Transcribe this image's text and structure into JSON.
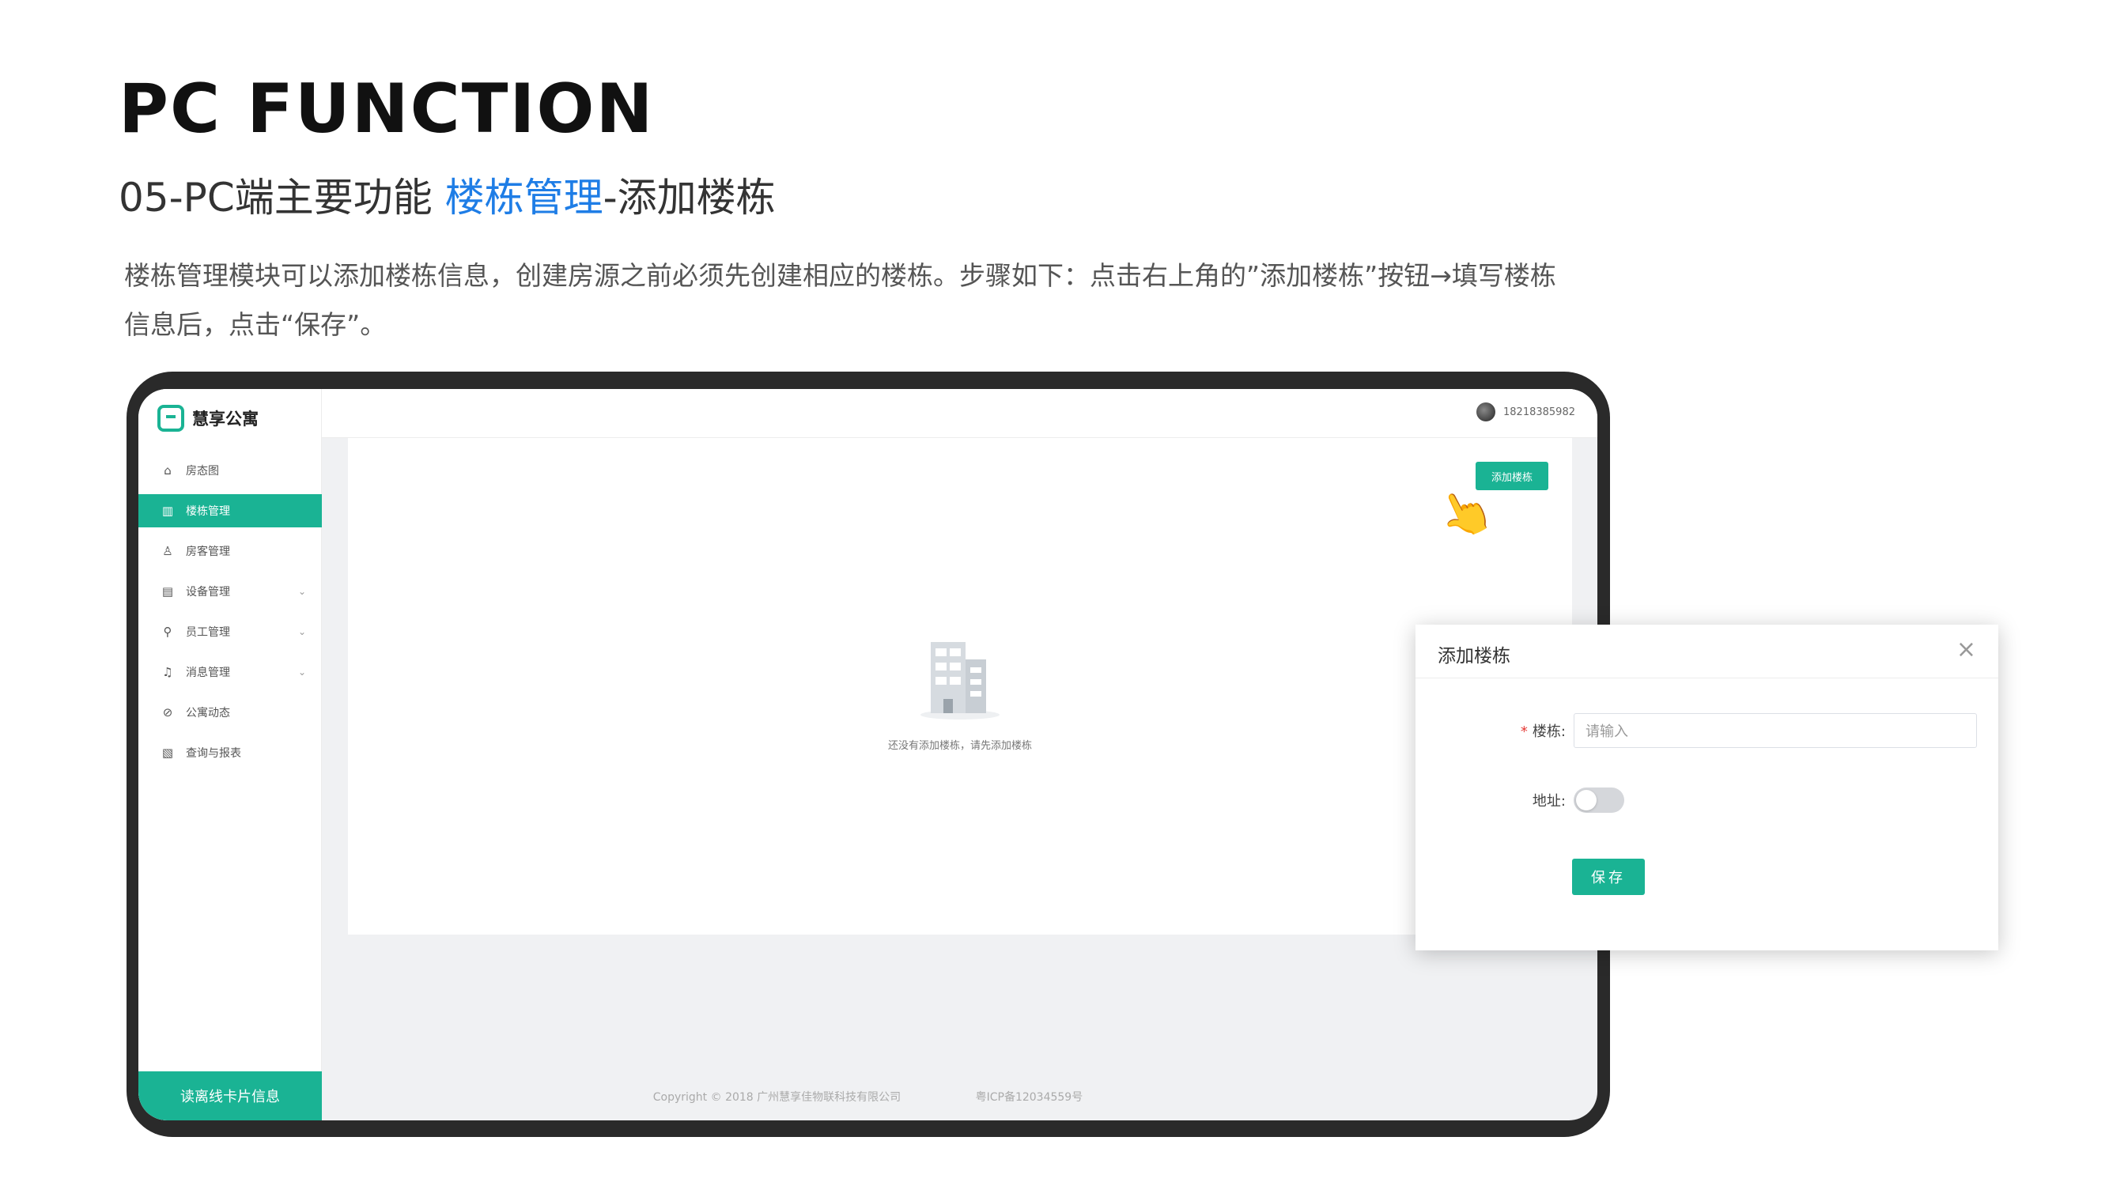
{
  "page": {
    "title": "PC FUNCTION",
    "subtitle_prefix": "05-PC端主要功能 ",
    "subtitle_accent": "楼栋管理",
    "subtitle_suffix": "-添加楼栋",
    "description": "楼栋管理模块可以添加楼栋信息，创建房源之前必须先创建相应的楼栋。步骤如下：点击右上角的”添加楼栋”按钮→填写楼栋信息后，点击“保存”。"
  },
  "app": {
    "logo_text": "慧享公寓",
    "user_phone": "18218385982",
    "sidebar": {
      "items": [
        {
          "label": "房态图",
          "icon": "home-icon",
          "active": false,
          "chevron": ""
        },
        {
          "label": "楼栋管理",
          "icon": "building-icon",
          "active": true,
          "chevron": ""
        },
        {
          "label": "房客管理",
          "icon": "user-icon",
          "active": false,
          "chevron": ""
        },
        {
          "label": "设备管理",
          "icon": "device-icon",
          "active": false,
          "chevron": "⌄"
        },
        {
          "label": "员工管理",
          "icon": "staff-icon",
          "active": false,
          "chevron": "⌄"
        },
        {
          "label": "消息管理",
          "icon": "bell-icon",
          "active": false,
          "chevron": "⌄"
        },
        {
          "label": "公寓动态",
          "icon": "compass-icon",
          "active": false,
          "chevron": ""
        },
        {
          "label": "查询与报表",
          "icon": "report-icon",
          "active": false,
          "chevron": ""
        }
      ],
      "footer_label": "读离线卡片信息"
    },
    "content": {
      "add_button": "添加楼栋",
      "empty_text": "还没有添加楼栋，请先添加楼栋"
    },
    "footer": {
      "copyright": "Copyright © 2018 广州慧享佳物联科技有限公司",
      "icp": "粤ICP备12034559号"
    }
  },
  "dialog": {
    "title": "添加楼栋",
    "building_label": "楼栋:",
    "building_placeholder": "请输入",
    "address_label": "地址:",
    "address_toggle_on": false,
    "save_label": "保存"
  },
  "colors": {
    "accent_green": "#1ab394",
    "accent_blue": "#1e7de6"
  }
}
